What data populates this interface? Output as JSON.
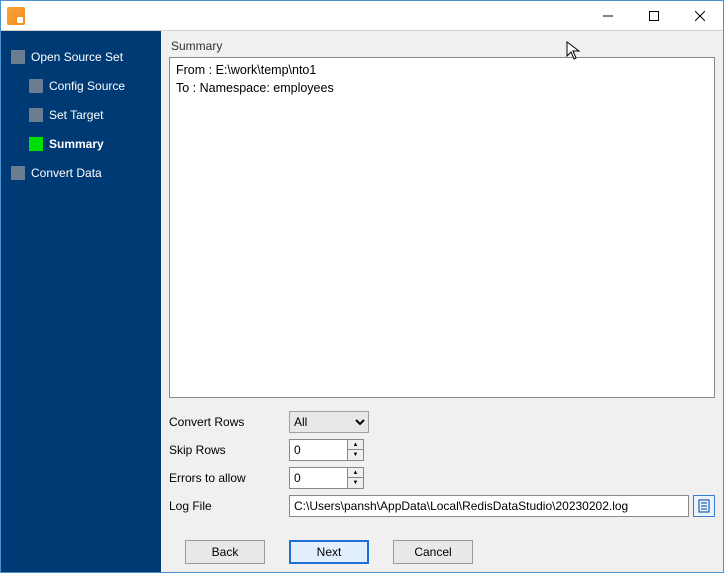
{
  "titlebar": {
    "title": ""
  },
  "sidebar": {
    "steps": [
      {
        "label": "Open Source Set"
      },
      {
        "label": "Config Source"
      },
      {
        "label": "Set Target"
      },
      {
        "label": "Summary"
      },
      {
        "label": "Convert Data"
      }
    ]
  },
  "main": {
    "section_title": "Summary",
    "summary_text": "From : E:\\work\\temp\\nto1\nTo : Namespace: employees",
    "convert_rows_label": "Convert Rows",
    "convert_rows_value": "All",
    "skip_rows_label": "Skip Rows",
    "skip_rows_value": "0",
    "errors_allow_label": "Errors to allow",
    "errors_allow_value": "0",
    "log_file_label": "Log File",
    "log_file_value": "C:\\Users\\pansh\\AppData\\Local\\RedisDataStudio\\20230202.log"
  },
  "buttons": {
    "back": "Back",
    "next": "Next",
    "cancel": "Cancel"
  }
}
